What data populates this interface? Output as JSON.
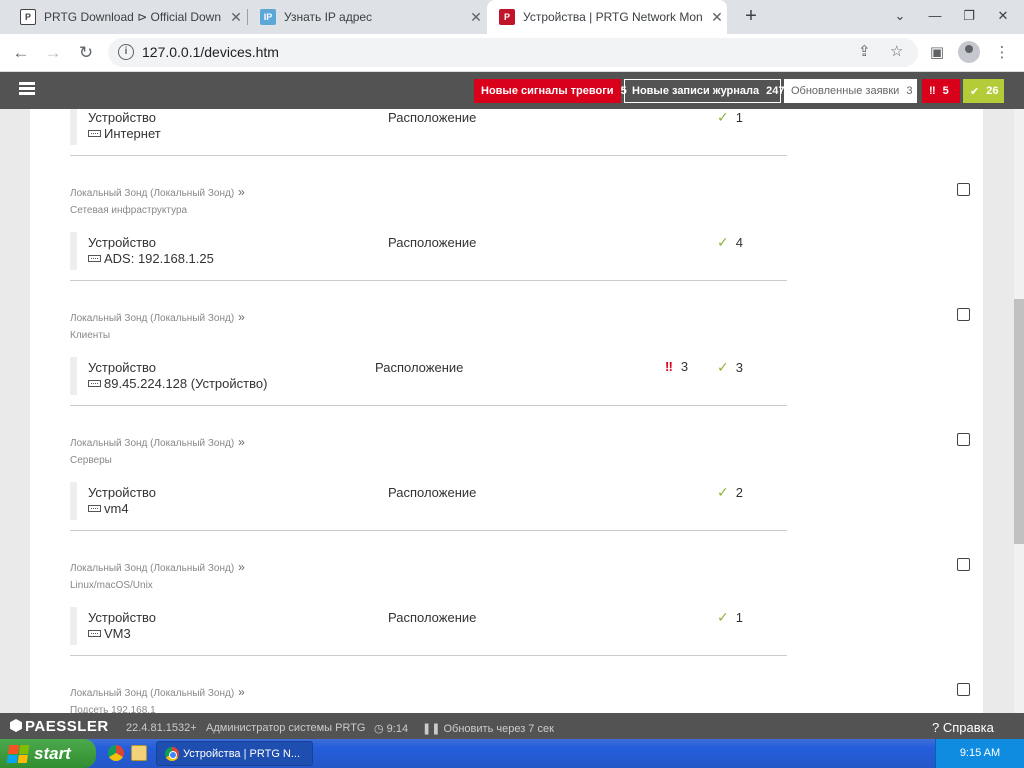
{
  "browser": {
    "tabs": [
      {
        "title": "PRTG Download ⊳ Official Down",
        "active": false
      },
      {
        "title": "Узнать IP адрес",
        "active": false
      },
      {
        "title": "Устройства | PRTG Network Mon",
        "active": true
      }
    ],
    "url": "127.0.0.1/devices.htm"
  },
  "header": {
    "alarms_label": "Новые сигналы тревоги",
    "alarms_count": "5",
    "log_label": "Новые записи журнала",
    "log_count": "247",
    "tickets_label": "Обновленные заявки",
    "tickets_count": "3",
    "down_count": "5",
    "up_count": "26",
    "colors": {
      "bar": "#535353",
      "down": "#d9001b",
      "up": "#b4cc38"
    }
  },
  "devices": {
    "device_label": "Устройство",
    "location_label": "Расположение",
    "probe": "Локальный Зонд (Локальный Зонд)",
    "items": [
      {
        "group": "",
        "name": "Интернет",
        "down": "",
        "up": "1"
      },
      {
        "group": "Сетевая инфраструктура",
        "name": "ADS: 192.168.1.25",
        "down": "",
        "up": "4"
      },
      {
        "group": "Клиенты",
        "name": "89.45.224.128 (Устройство)",
        "down": "3",
        "up": "3"
      },
      {
        "group": "Серверы",
        "name": "vm4",
        "down": "",
        "up": "2"
      },
      {
        "group": "Linux/macOS/Unix",
        "name": "VM3",
        "down": "",
        "up": "1"
      },
      {
        "group": "Подсеть 192.168.1",
        "name": "",
        "down": "",
        "up": ""
      }
    ]
  },
  "footer": {
    "brand": "PAESSLER",
    "version": "22.4.81.1532+",
    "user": "Администратор системы PRTG",
    "time": "9:14",
    "refresh": "Обновить через 7 сек",
    "help": "Справка"
  },
  "taskbar": {
    "start": "start",
    "window": "Устройства | PRTG N...",
    "clock": "9:15 AM"
  }
}
